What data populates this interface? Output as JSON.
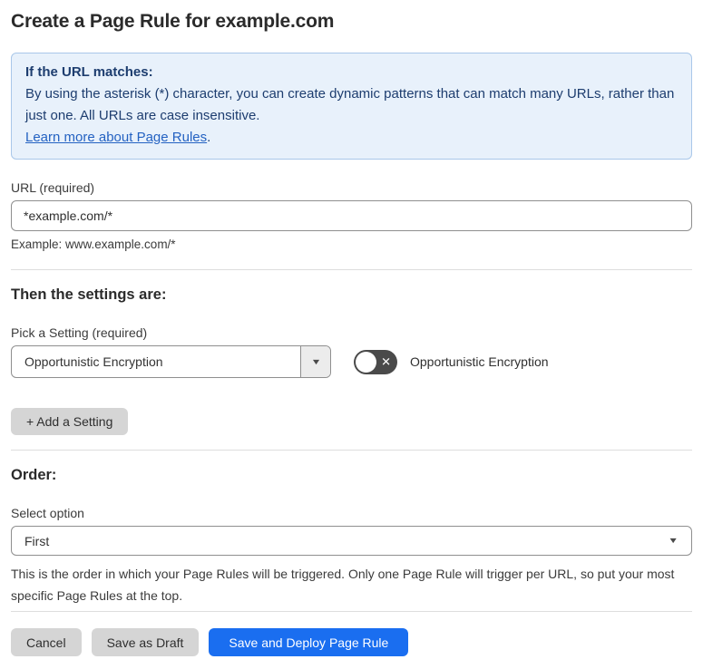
{
  "page": {
    "title": "Create a Page Rule for example.com"
  },
  "info_box": {
    "heading": "If the URL matches:",
    "body": "By using the asterisk (*) character, you can create dynamic patterns that can match many URLs, rather than just one. All URLs are case insensitive.",
    "link_label": "Learn more about Page Rules",
    "link_suffix": "."
  },
  "url_field": {
    "label": "URL (required)",
    "value": "*example.com/*",
    "hint": "Example: www.example.com/*"
  },
  "settings_section": {
    "heading": "Then the settings are:",
    "setting_label": "Pick a Setting (required)",
    "setting_value": "Opportunistic Encryption",
    "toggle": {
      "label": "Opportunistic Encryption",
      "state": "off",
      "off_icon": "✕"
    },
    "add_setting_label": "+ Add a Setting"
  },
  "order_section": {
    "heading": "Order:",
    "select_label": "Select option",
    "select_value": "First",
    "help_text": "This is the order in which your Page Rules will be triggered. Only one Page Rule will trigger per URL, so put your most specific Page Rules at the top."
  },
  "actions": {
    "cancel_label": "Cancel",
    "save_draft_label": "Save as Draft",
    "save_deploy_label": "Save and Deploy Page Rule"
  },
  "icons": {
    "select_arrow": "▼"
  },
  "colors": {
    "primary_blue": "#1a6ef0",
    "info_background": "#e8f1fb",
    "info_border": "#a9c7e9",
    "info_text": "#1d3d6f",
    "link_blue": "#2462c2",
    "toggle_off_background": "#4a4a4a",
    "gray_button": "#d5d5d5"
  }
}
